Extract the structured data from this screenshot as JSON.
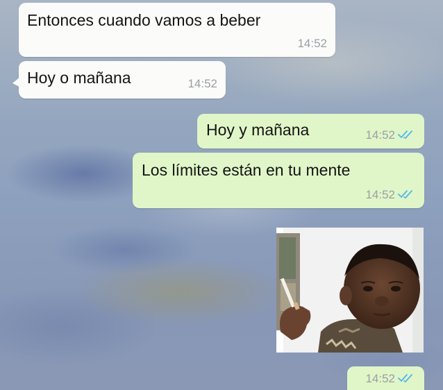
{
  "chat": {
    "messages": [
      {
        "direction": "incoming",
        "text": "Entonces cuando vamos a beber",
        "time": "14:52"
      },
      {
        "direction": "incoming",
        "text": "Hoy o mañana",
        "time": "14:52"
      },
      {
        "direction": "outgoing",
        "text": "Hoy y mañana",
        "time": "14:52",
        "status": "read"
      },
      {
        "direction": "outgoing",
        "text": "Los límites están en tu mente",
        "time": "14:52",
        "status": "read"
      },
      {
        "direction": "outgoing",
        "type": "sticker",
        "sticker": "boy-smoking-cigarette",
        "time": "14:52",
        "status": "read"
      }
    ]
  },
  "colors": {
    "incoming_bubble": "#fbfbfa",
    "outgoing_bubble": "#e0f6c8",
    "read_ticks": "#4fb6ec",
    "timestamp": "#9a9fa3"
  }
}
